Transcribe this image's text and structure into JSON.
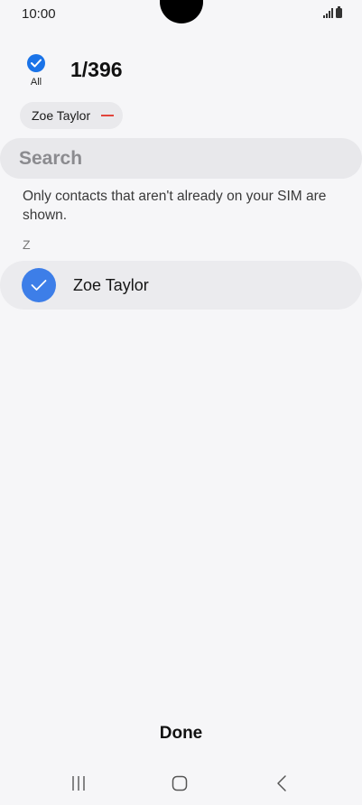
{
  "status_bar": {
    "time": "10:00"
  },
  "header": {
    "all_label": "All",
    "count": "1/396"
  },
  "selected_chips": [
    {
      "label": "Zoe Taylor"
    }
  ],
  "search": {
    "placeholder": "Search"
  },
  "info_text": "Only contacts that aren't already on your SIM are shown.",
  "section": {
    "letter": "Z"
  },
  "contacts": [
    {
      "name": "Zoe Taylor",
      "selected": true
    }
  ],
  "footer": {
    "done_label": "Done"
  },
  "colors": {
    "accent": "#1a73e8",
    "remove": "#e2453c",
    "background": "#f6f6f8"
  },
  "icons": [
    "check-icon",
    "remove-icon",
    "signal-icon",
    "battery-icon",
    "recents-icon",
    "home-icon",
    "back-icon"
  ]
}
